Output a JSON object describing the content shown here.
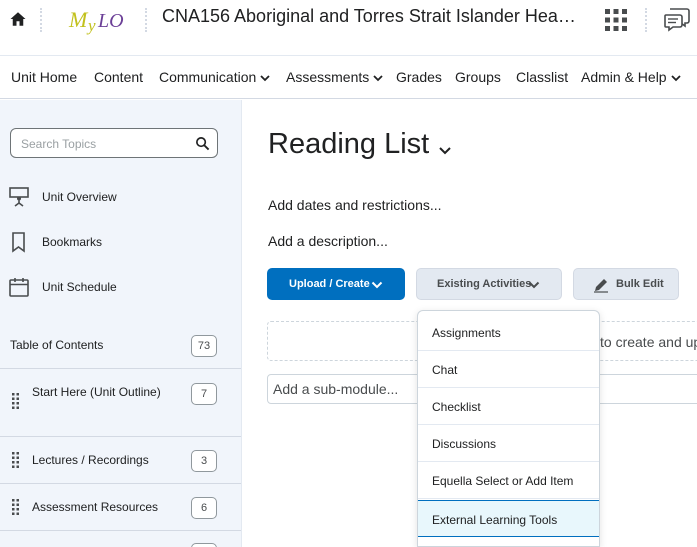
{
  "header": {
    "logo_text": "MyLO",
    "course_title": "CNA156 Aboriginal and Torres Strait Islander Hea…"
  },
  "nav": {
    "items": [
      {
        "label": "Unit Home"
      },
      {
        "label": "Content"
      },
      {
        "label": "Communication"
      },
      {
        "label": "Assessments"
      },
      {
        "label": "Grades"
      },
      {
        "label": "Groups"
      },
      {
        "label": "Classlist"
      },
      {
        "label": "Admin & Help"
      }
    ]
  },
  "sidebar": {
    "search_placeholder": "Search Topics",
    "links": [
      {
        "label": "Unit Overview",
        "icon": "presentation-icon"
      },
      {
        "label": "Bookmarks",
        "icon": "bookmark-icon"
      },
      {
        "label": "Unit Schedule",
        "icon": "calendar-icon"
      }
    ],
    "toc": {
      "label": "Table of Contents",
      "count": "73"
    },
    "modules": [
      {
        "label": "Start Here (Unit Outline)",
        "count": "7"
      },
      {
        "label": "Lectures / Recordings",
        "count": "3"
      },
      {
        "label": "Assessment Resources",
        "count": "6"
      }
    ]
  },
  "main": {
    "title": "Reading List",
    "add_dates": "Add dates and restrictions...",
    "add_description": "Add a description...",
    "upload_button": "Upload / Create",
    "existing_button": "Existing Activities",
    "bulk_button": "Bulk Edit",
    "dropzone_text": "to create and up",
    "submodule_text": "Add a sub-module..."
  },
  "menu": {
    "items": [
      {
        "label": "Assignments"
      },
      {
        "label": "Chat"
      },
      {
        "label": "Checklist"
      },
      {
        "label": "Discussions"
      },
      {
        "label": "Equella Select or Add Item"
      },
      {
        "label": "External Learning Tools"
      }
    ],
    "highlighted_index": 5
  },
  "colors": {
    "primary": "#006fbf",
    "logo_yellow": "#c2c11d",
    "logo_purple": "#6b3f97",
    "sidebar_bg": "#f1f5fb",
    "menu_highlight": "#e8f7fc"
  }
}
